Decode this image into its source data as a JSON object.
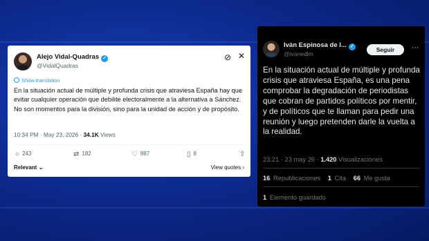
{
  "background": {
    "color": "#0c2a8e"
  },
  "tweet_light": {
    "author_name": "Alejo Vidal-Quadras",
    "handle": "@VidalQuadras",
    "verified_mark": "✓",
    "grok_icon": "⊘",
    "close_icon": "✕",
    "show_translation": "Show translation",
    "text": "En la situación actual de múltiple y profunda crisis que atraviesa España hay que evitar cualquier operación que debilite electoralmente a la alternativa a Sánchez. No son momentos para la división, sino para la unidad de acción y de propósito.",
    "time": "10:34 PM · May 23, 2026 · ",
    "views_count": "34.1K",
    "views_label": " Views",
    "actions": {
      "replies": "243",
      "reposts": "182",
      "likes": "887",
      "bookmarks": "8"
    },
    "relevant_label": "Relevant ⌄",
    "view_quotes_label": "View quotes ›",
    "accent": "#1d9bf0"
  },
  "tweet_dark": {
    "author_name": "Iván Espinosa de l...",
    "handle": "@ivanedlm",
    "verified_mark": "✓",
    "follow_label": "Seguir",
    "more_icon": "⋯",
    "text": "En la situación actual de múltiple y profunda crisis que atraviesa España, es una pena comprobar la degradación de periodistas que cobran de partidos políticos por mentir, y de políticos que te llaman para pedir una reunión y luego pretenden darle la vuelta a la realidad.",
    "time": "23:21 · 23 may 26 · ",
    "views_count": "1.420",
    "views_label": " Visualizaciones",
    "reposts_count": "16",
    "reposts_label": "Republicaciones",
    "quotes_count": "1",
    "quotes_label": "Cita",
    "likes_count": "66",
    "likes_label": "Me gusta",
    "saved_count": "1",
    "saved_label": "Elemento guardado"
  }
}
